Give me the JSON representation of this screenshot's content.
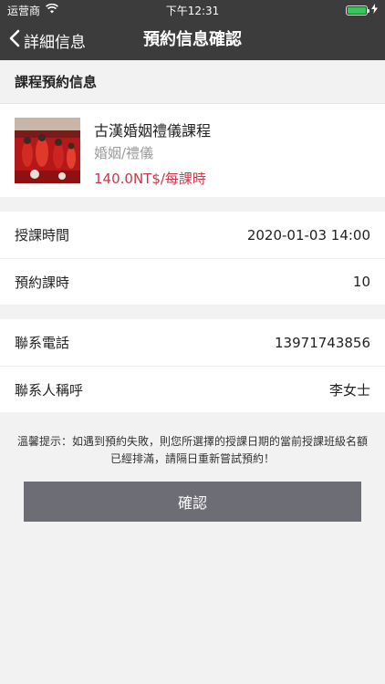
{
  "status_bar": {
    "carrier": "运营商",
    "time": "下午12:31",
    "battery_level": 1.0
  },
  "nav": {
    "back_label": "詳細信息",
    "title": "預約信息確認"
  },
  "section": {
    "title": "課程預約信息"
  },
  "course": {
    "name": "古漢婚姻禮儀課程",
    "category": "婚姻/禮儀",
    "price": "140.0NT$/每課時"
  },
  "booking": [
    {
      "label": "授課時間",
      "value": "2020-01-03 14:00"
    },
    {
      "label": "預約課時",
      "value": "10"
    }
  ],
  "contact": [
    {
      "label": "聯系電話",
      "value": "13971743856"
    },
    {
      "label": "聯系人稱呼",
      "value": "李女士"
    }
  ],
  "tip": "溫馨提示：如遇到預約失敗，則您所選擇的授課日期的當前授課班級名額已經排滿，請隔日重新嘗試預約！",
  "confirm_label": "確認",
  "colors": {
    "bar": "#3c3c3c",
    "price": "#c8384b",
    "button": "#6d6d76",
    "battery": "#34c759"
  }
}
